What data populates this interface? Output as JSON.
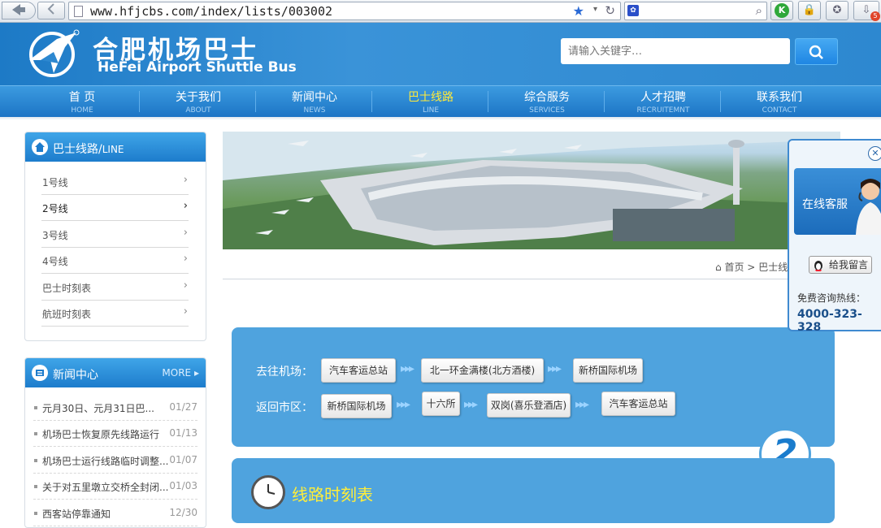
{
  "browser": {
    "url": "www.hfjcbs.com/index/lists/003002",
    "badge_count": "5"
  },
  "site": {
    "logo_cn": "合肥机场巴士",
    "logo_en": "HeFei Airport Shuttle Bus",
    "search_placeholder": "请输入关键字…"
  },
  "nav": [
    {
      "cn": "首 页",
      "en": "HOME"
    },
    {
      "cn": "关于我们",
      "en": "ABOUT"
    },
    {
      "cn": "新闻中心",
      "en": "NEWS"
    },
    {
      "cn": "巴士线路",
      "en": "LINE"
    },
    {
      "cn": "综合服务",
      "en": "SERVICES"
    },
    {
      "cn": "人才招聘",
      "en": "RECRUITEMNT"
    },
    {
      "cn": "联系我们",
      "en": "CONTACT"
    }
  ],
  "line_panel": {
    "title": "巴士线路/",
    "title_en": "LINE",
    "items": [
      "1号线",
      "2号线",
      "3号线",
      "4号线",
      "巴士时刻表",
      "航班时刻表"
    ],
    "arrow": "›"
  },
  "news_panel": {
    "title": "新闻中心",
    "more": "MORE",
    "items": [
      {
        "title": "元月30日、元月31日巴...",
        "date": "01/27"
      },
      {
        "title": "机场巴士恢复原先线路运行",
        "date": "01/13"
      },
      {
        "title": "机场巴士运行线路临时调整...",
        "date": "01/07"
      },
      {
        "title": "关于对五里墩立交桥全封闭...",
        "date": "01/03"
      },
      {
        "title": "西客站停靠通知",
        "date": "12/30"
      }
    ]
  },
  "breadcrumb": {
    "home": "首页",
    "sep": ">",
    "current": "巴士线"
  },
  "route": {
    "to_airport_label": "去往机场：",
    "to_airport_stops": [
      "汽车客运总站",
      "北一环金满楼(北方酒楼)",
      "新桥国际机场"
    ],
    "return_label": "返回市区：",
    "return_stops": [
      "新桥国际机场",
      "十六所",
      "双岗(喜乐登酒店)",
      "汽车客运总站"
    ],
    "line_number": "2"
  },
  "schedule": {
    "title": "线路时刻表"
  },
  "online_service": {
    "title": "在线客服",
    "message_btn": "给我留言",
    "hotline_label": "免费咨询热线：",
    "hotline": "4000-323-328"
  }
}
